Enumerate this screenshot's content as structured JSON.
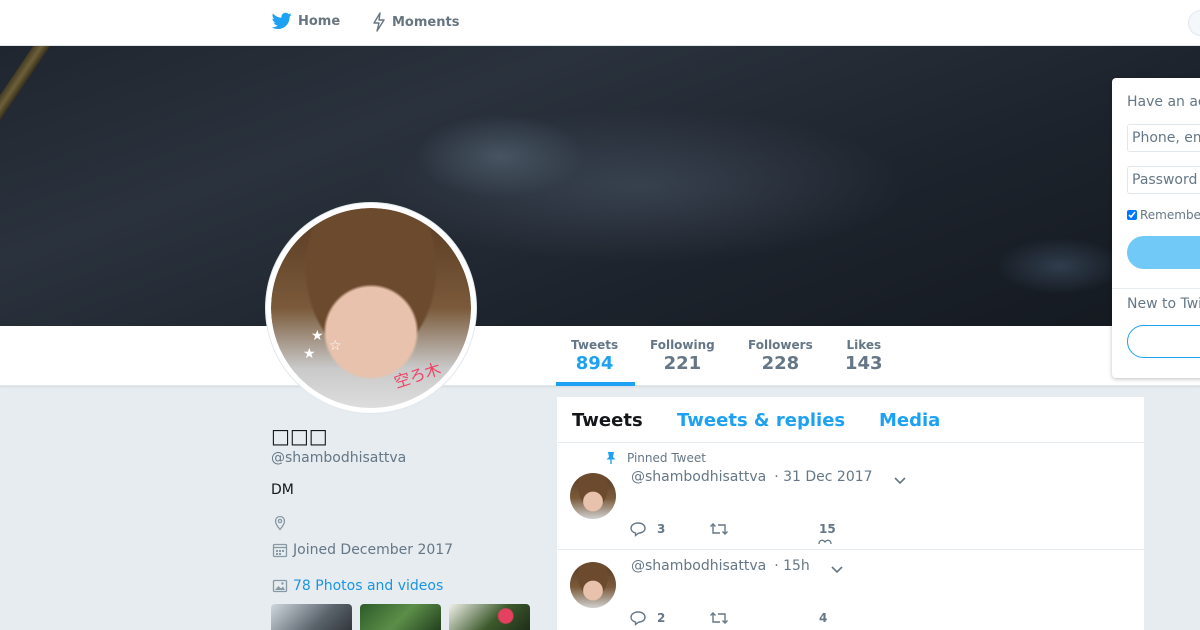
{
  "nav": {
    "home_label": "Home",
    "moments_label": "Moments"
  },
  "profile": {
    "display_name": "□□□",
    "handle": "@shambodhisattva",
    "bio": "DM",
    "joined": "Joined December 2017",
    "photos_label": "78 Photos and videos",
    "avatar_watermark": "空ろ木"
  },
  "stats": [
    {
      "label": "Tweets",
      "value": "894"
    },
    {
      "label": "Following",
      "value": "221"
    },
    {
      "label": "Followers",
      "value": "228"
    },
    {
      "label": "Likes",
      "value": "143"
    }
  ],
  "timeline": {
    "tabs": [
      "Tweets",
      "Tweets & replies",
      "Media"
    ],
    "pinned_label": "Pinned Tweet",
    "tweets": [
      {
        "handle": "@shambodhisattva",
        "time": "· 31 Dec 2017",
        "replies": "3",
        "retweets": "",
        "likes": "15"
      },
      {
        "handle": "@shambodhisattva",
        "time": "· 15h",
        "replies": "2",
        "retweets": "",
        "likes": "4"
      }
    ]
  },
  "login": {
    "title": "Have an ac",
    "phone_placeholder": "Phone, em",
    "password_placeholder": "Password",
    "remember_label": "Remembe",
    "new_label": "New to Twi"
  },
  "colors": {
    "accent": "#1da1f2",
    "background": "#e6ecf0",
    "muted_text": "#657786"
  },
  "icons": [
    "twitter-bird-icon",
    "lightning-icon",
    "location-icon",
    "calendar-icon",
    "photo-icon",
    "pin-icon",
    "reply-icon",
    "retweet-icon",
    "heart-icon",
    "chevron-down-icon"
  ]
}
